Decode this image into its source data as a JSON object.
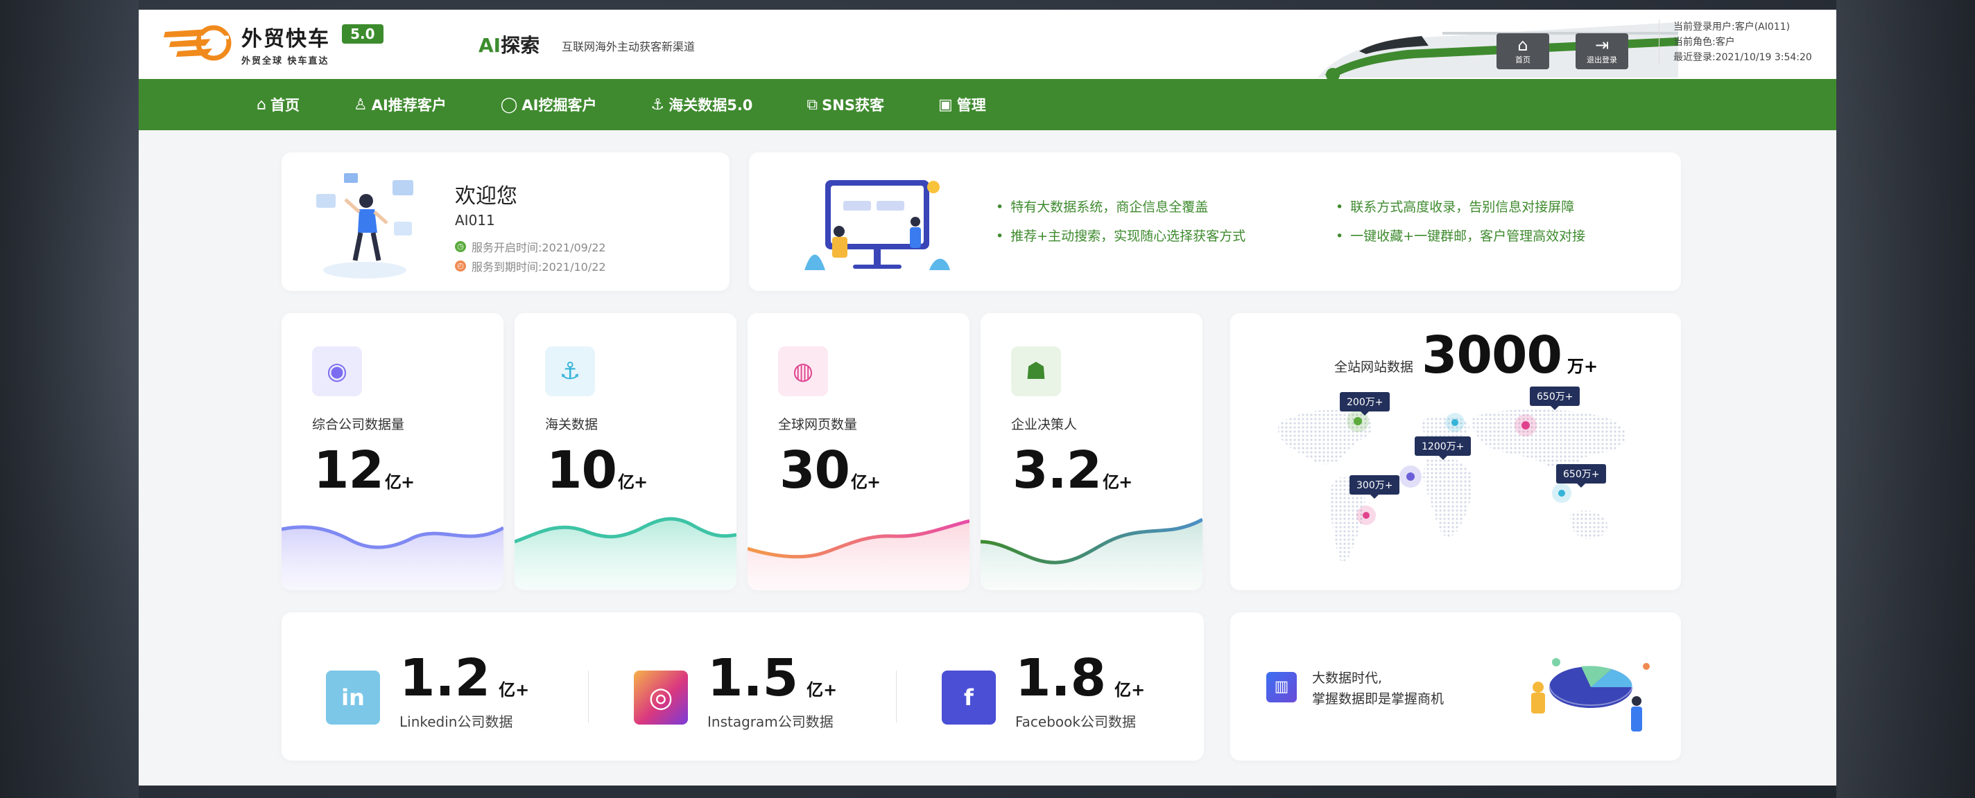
{
  "header": {
    "logo_title": "外贸快车",
    "logo_subtitle": "外贸全球 快车直达",
    "version": "5.0",
    "ai_prefix": "AI",
    "ai_title": "探索",
    "ai_desc": "互联网海外主动获客新渠道",
    "buttons": [
      {
        "label": "首页",
        "icon": "home-icon"
      },
      {
        "label": "退出登录",
        "icon": "logout-icon"
      }
    ],
    "user": {
      "current_user": "当前登录用户:客户(AI011)",
      "role": "当前角色:客户",
      "last_login": "最近登录:2021/10/19 3:54:20"
    }
  },
  "nav": {
    "items": [
      {
        "label": "首页",
        "icon": "home-icon"
      },
      {
        "label": "AI推荐客户",
        "icon": "user-icon"
      },
      {
        "label": "AI挖掘客户",
        "icon": "chat-icon"
      },
      {
        "label": "海关数据5.0",
        "icon": "anchor-icon"
      },
      {
        "label": "SNS获客",
        "icon": "share-icon"
      },
      {
        "label": "管理",
        "icon": "manage-icon"
      }
    ]
  },
  "welcome": {
    "title": "欢迎您",
    "username": "AI011",
    "service_start": "服务开启时间:2021/09/22",
    "service_end": "服务到期时间:2021/10/22"
  },
  "features": [
    "特有大数据系统，商企信息全覆盖",
    "推荐+主动搜索，实现随心选择获客方式",
    "联系方式高度收录，告别信息对接屏障",
    "一键收藏+一键群邮，客户管理高效对接"
  ],
  "stats": [
    {
      "label": "综合公司数据量",
      "value": "12",
      "unit": "亿+",
      "icon": "planet-icon",
      "color": "#7b6cf0"
    },
    {
      "label": "海关数据",
      "value": "10",
      "unit": "亿+",
      "icon": "anchor-icon",
      "color": "#36b4d8"
    },
    {
      "label": "全球网页数量",
      "value": "30",
      "unit": "亿+",
      "icon": "globe-icon",
      "color": "#e0438e"
    },
    {
      "label": "企业决策人",
      "value": "3.2",
      "unit": "亿+",
      "icon": "people-icon",
      "color": "#3f8a2f"
    }
  ],
  "world": {
    "label": "全站网站数据",
    "value": "3000",
    "unit": "万+",
    "tags": [
      "200万+",
      "650万+",
      "1200万+",
      "300万+",
      "650万+"
    ]
  },
  "social": [
    {
      "value": "1.2",
      "unit": "亿+",
      "label": "Linkedin公司数据",
      "icon": "linkedin-icon",
      "glyph": "in",
      "color": "#7cc7e8"
    },
    {
      "value": "1.5",
      "unit": "亿+",
      "label": "Instagram公司数据",
      "icon": "instagram-icon",
      "glyph": "◎",
      "color": "#d9387f"
    },
    {
      "value": "1.8",
      "unit": "亿+",
      "label": "Facebook公司数据",
      "icon": "facebook-icon",
      "glyph": "f",
      "color": "#4a4fd6"
    }
  ],
  "bigdata": {
    "line1": "大数据时代,",
    "line2": "掌握数据即是掌握商机"
  }
}
